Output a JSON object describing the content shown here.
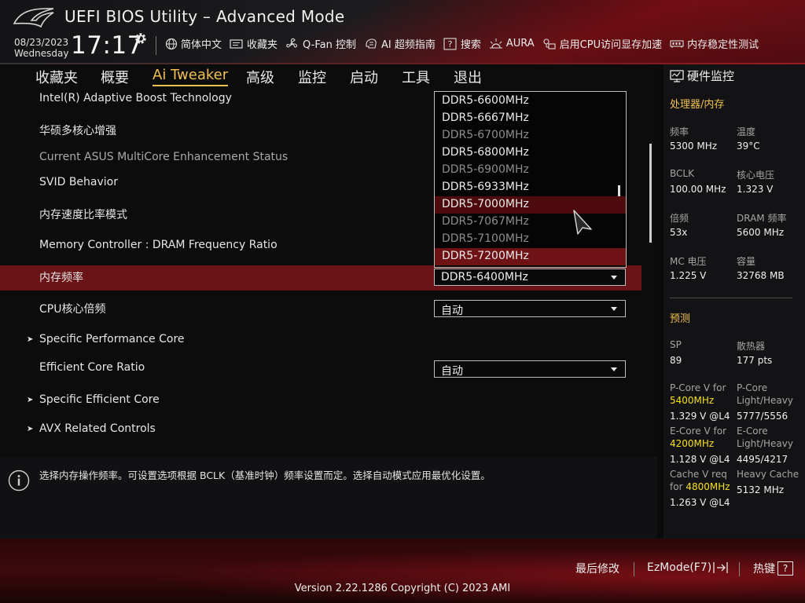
{
  "header": {
    "title": "UEFI BIOS Utility – Advanced Mode",
    "date": "08/23/2023",
    "weekday": "Wednesday",
    "time": "17:17",
    "toolbar": [
      {
        "icon": "globe-icon",
        "label": "简体中文"
      },
      {
        "icon": "favorites-icon",
        "label": "收藏夹"
      },
      {
        "icon": "fan-icon",
        "label": "Q-Fan 控制"
      },
      {
        "icon": "ai-guide-icon",
        "label": "AI 超频指南"
      },
      {
        "icon": "search-icon",
        "label": "搜索"
      },
      {
        "icon": "aura-icon",
        "label": "AURA"
      },
      {
        "icon": "cpu-access-icon",
        "label": "启用CPU访问显存加速"
      },
      {
        "icon": "memory-test-icon",
        "label": "内存稳定性测试"
      }
    ]
  },
  "tabs": [
    "收藏夹",
    "概要",
    "Ai Tweaker",
    "高级",
    "监控",
    "启动",
    "工具",
    "退出"
  ],
  "active_tab": "Ai Tweaker",
  "settings": {
    "intel_abt": "Intel(R) Adaptive Boost Technology",
    "mce": "华硕多核心增强",
    "mce_status": "Current ASUS MultiCore Enhancement Status",
    "svid": "SVID Behavior",
    "mem_ratio_mode": "内存速度比率模式",
    "mc_ratio": "Memory Controller : DRAM Frequency Ratio",
    "mem_freq": "内存频率",
    "mem_freq_value": "DDR5-6400MHz",
    "cpu_ratio": "CPU核心倍频",
    "cpu_ratio_value": "自动",
    "spec_p_core": "Specific Performance Core",
    "e_core_ratio": "Efficient Core Ratio",
    "e_core_ratio_value": "自动",
    "spec_e_core": "Specific Efficient Core",
    "avx": "AVX Related Controls"
  },
  "dropdown_options": [
    {
      "label": "DDR5-6600MHz",
      "state": "enabled"
    },
    {
      "label": "DDR5-6667MHz",
      "state": "enabled"
    },
    {
      "label": "DDR5-6700MHz",
      "state": "disabled"
    },
    {
      "label": "DDR5-6800MHz",
      "state": "enabled"
    },
    {
      "label": "DDR5-6900MHz",
      "state": "disabled"
    },
    {
      "label": "DDR5-6933MHz",
      "state": "enabled"
    },
    {
      "label": "DDR5-7000MHz",
      "state": "hover"
    },
    {
      "label": "DDR5-7067MHz",
      "state": "disabled"
    },
    {
      "label": "DDR5-7100MHz",
      "state": "disabled"
    },
    {
      "label": "DDR5-7200MHz",
      "state": "selected"
    }
  ],
  "help_text": "选择内存操作频率。可设置选项根据 BCLK（基准时钟）频率设置而定。选择自动模式应用最优化设置。",
  "monitor": {
    "title": "硬件监控",
    "cpu_mem": {
      "heading": "处理器/内存",
      "freq_label": "频率",
      "freq_value": "5300 MHz",
      "temp_label": "温度",
      "temp_value": "39°C",
      "bclk_label": "BCLK",
      "bclk_value": "100.00 MHz",
      "vcore_label": "核心电压",
      "vcore_value": "1.323 V",
      "ratio_label": "倍频",
      "ratio_value": "53x",
      "dram_freq_label": "DRAM 频率",
      "dram_freq_value": "5600 MHz",
      "mc_volt_label": "MC 电压",
      "mc_volt_value": "1.225 V",
      "capacity_label": "容量",
      "capacity_value": "32768 MB"
    },
    "prediction": {
      "heading": "预测",
      "sp_label": "SP",
      "sp_value": "89",
      "cooler_label": "散热器",
      "cooler_value": "177 pts",
      "pcore_v_label": "P-Core V for",
      "pcore_v_freq": "5400MHz",
      "pcore_v_value": "1.329 V @L4",
      "pcore_lh_label1": "P-Core",
      "pcore_lh_label2": "Light/Heavy",
      "pcore_lh_value": "5777/5556",
      "ecore_v_label": "E-Core V for",
      "ecore_v_freq": "4200MHz",
      "ecore_v_value": "1.128 V @L4",
      "ecore_lh_label1": "E-Core",
      "ecore_lh_label2": "Light/Heavy",
      "ecore_lh_value": "4495/4217",
      "cache_v_label1": "Cache V req",
      "cache_v_label2": "for",
      "cache_v_freq": "4800MHz",
      "cache_v_value": "1.263 V @L4",
      "heavy_cache_label": "Heavy Cache",
      "heavy_cache_value": "5132 MHz"
    }
  },
  "footer": {
    "last_modified": "最后修改",
    "ezmode": "EzMode(F7)",
    "hotkeys": "热键",
    "hotkeys_key": "?",
    "version": "Version 2.22.1286 Copyright (C) 2023 AMI"
  },
  "colors": {
    "accent": "#f0c050",
    "highlight_row": "#6b1418",
    "predict_freq": "#f5e020"
  }
}
